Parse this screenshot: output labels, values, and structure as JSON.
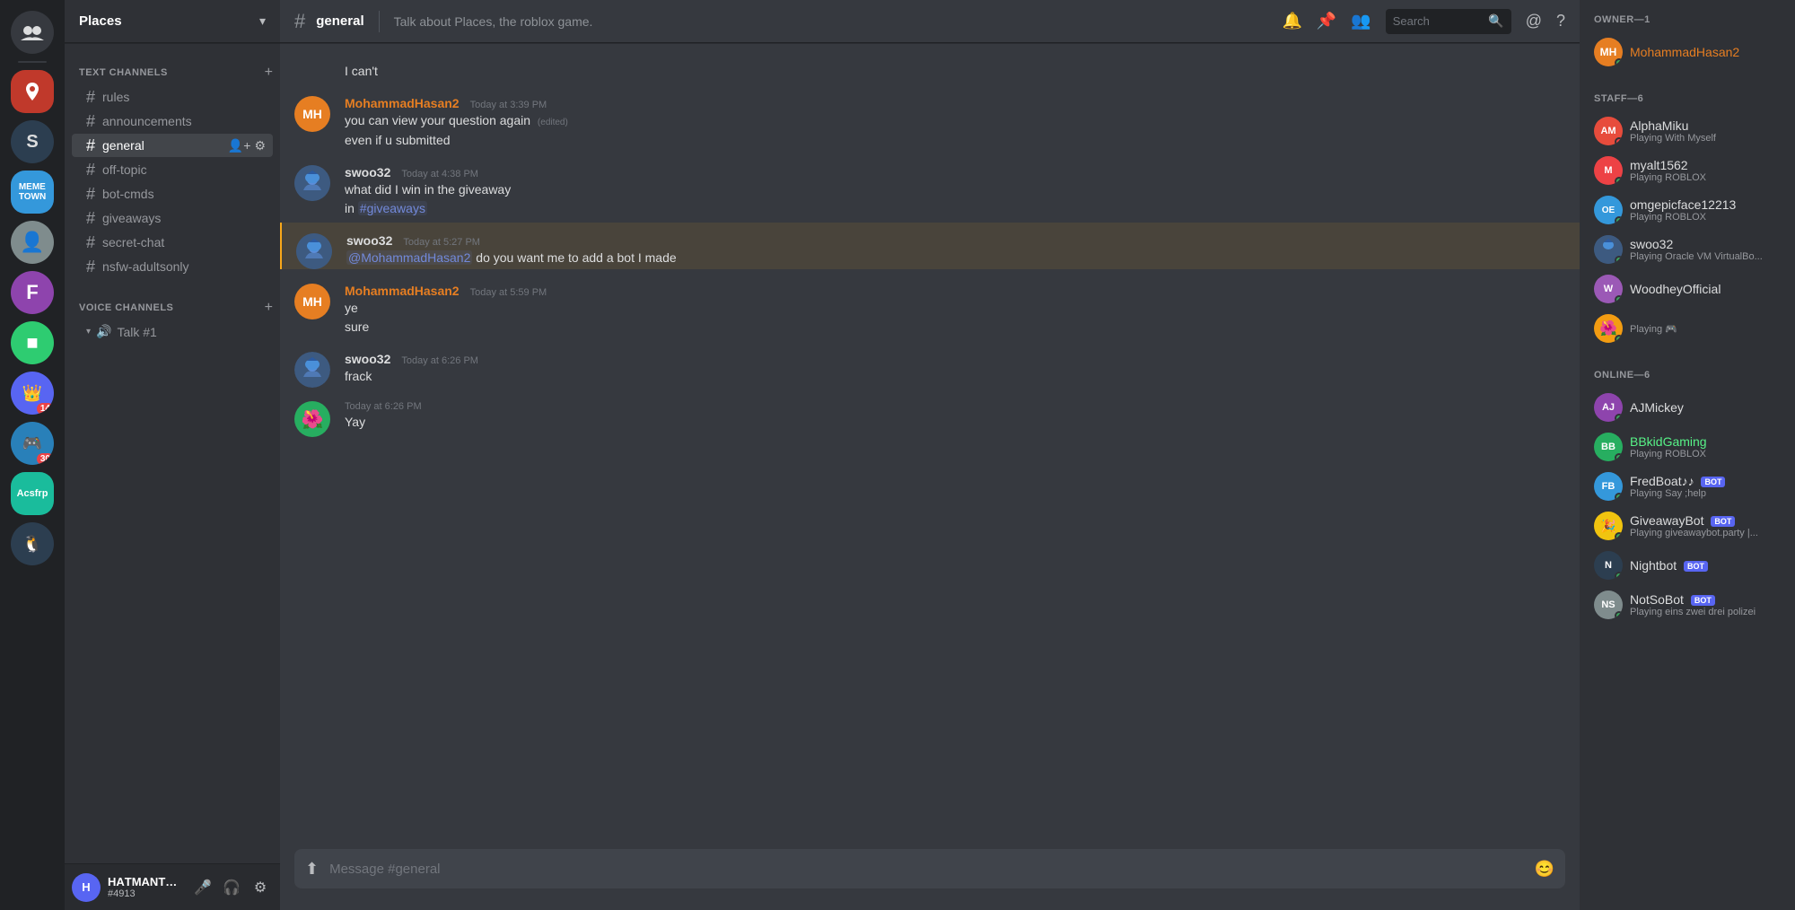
{
  "serverList": {
    "servers": [
      {
        "id": "dm",
        "label": "DM",
        "icon": "👥",
        "color": "#36393f"
      },
      {
        "id": "places",
        "label": "Places",
        "icon": "📍",
        "color": "#e74c3c",
        "active": false
      },
      {
        "id": "s",
        "label": "S",
        "icon": "S",
        "color": "#2c3e50"
      },
      {
        "id": "meme-town",
        "label": "Meme Town",
        "icon": "MT",
        "color": "#3498db"
      },
      {
        "id": "server5",
        "label": "",
        "icon": "👤",
        "color": "#95a5a6"
      },
      {
        "id": "server6",
        "label": "",
        "icon": "F",
        "color": "#e74c3c"
      },
      {
        "id": "server7",
        "label": "",
        "icon": "●",
        "color": "#2ecc71"
      },
      {
        "id": "server8",
        "label": "",
        "icon": "👑",
        "color": "#8e44ad",
        "badge": "14"
      },
      {
        "id": "server9",
        "label": "",
        "icon": "🎮",
        "color": "#2980b9",
        "badge": "30"
      },
      {
        "id": "acsfrp",
        "label": "Acsfrp",
        "icon": "AC",
        "color": "#1abc9c"
      },
      {
        "id": "server11",
        "label": "",
        "icon": "🐧",
        "color": "#27ae60"
      }
    ]
  },
  "sidebar": {
    "serverName": "Places",
    "textChannelsLabel": "TEXT CHANNELS",
    "voiceChannelsLabel": "VOICE CHANNELS",
    "channels": [
      {
        "name": "rules",
        "id": "rules"
      },
      {
        "name": "announcements",
        "id": "announcements"
      },
      {
        "name": "general",
        "id": "general",
        "active": true
      },
      {
        "name": "off-topic",
        "id": "off-topic"
      },
      {
        "name": "bot-cmds",
        "id": "bot-cmds"
      },
      {
        "name": "giveaways",
        "id": "giveaways"
      },
      {
        "name": "secret-chat",
        "id": "secret-chat"
      },
      {
        "name": "nsfw-adultsonly",
        "id": "nsfw",
        "locked": true
      }
    ],
    "voiceChannels": [
      {
        "name": "Talk #1",
        "id": "talk1"
      }
    ]
  },
  "currentUser": {
    "name": "ΗΑTΜΑNTH...",
    "discrim": "#4913",
    "avatarColor": "#5865f2"
  },
  "channelHeader": {
    "hash": "#",
    "name": "general",
    "topic": "Talk about Places, the roblox game.",
    "searchPlaceholder": "Search"
  },
  "messages": [
    {
      "id": "msg0",
      "continuedFrom": "swoo32",
      "content": "I can't",
      "avatarShow": false
    },
    {
      "id": "msg1",
      "author": "MohammadHasan2",
      "authorColor": "orange",
      "timestamp": "Today at 3:39 PM",
      "lines": [
        "you can view your question again",
        "even if u submitted"
      ],
      "edited": true,
      "hasAvatar": true,
      "avatarColor": "#e67e22",
      "avatarText": "MH"
    },
    {
      "id": "msg2",
      "author": "swoo32",
      "authorColor": "default",
      "timestamp": "Today at 4:38 PM",
      "lines": [
        "what did I win in the giveaway",
        "in #giveaways"
      ],
      "hasLink": true,
      "hasAvatar": true,
      "avatarColor": "#3d5a80",
      "avatarText": "S",
      "showHoverTools": true
    },
    {
      "id": "msg3",
      "author": "swoo32",
      "authorColor": "default",
      "timestamp": "Today at 5:27 PM",
      "lines": [
        "@MohammadHasan2 do you want me to add a bot I made"
      ],
      "hasMention": true,
      "highlighted": true,
      "hasAvatar": true,
      "avatarColor": "#3d5a80",
      "avatarText": "S"
    },
    {
      "id": "msg4",
      "author": "MohammadHasan2",
      "authorColor": "orange",
      "timestamp": "Today at 5:59 PM",
      "lines": [
        "ye",
        "sure"
      ],
      "hasAvatar": true,
      "avatarColor": "#e67e22",
      "avatarText": "MH"
    },
    {
      "id": "msg5",
      "author": "swoo32",
      "authorColor": "default",
      "timestamp": "Today at 6:26 PM",
      "lines": [
        "frack"
      ],
      "hasAvatar": true,
      "avatarColor": "#3d5a80",
      "avatarText": "S"
    },
    {
      "id": "msg6",
      "author": "",
      "timestamp": "Today at 6:26 PM",
      "lines": [
        "Yay"
      ],
      "hasAvatar": true,
      "avatarColor": "#f39c12",
      "avatarText": "🌺",
      "isBot": false,
      "showTimestampOnly": true
    }
  ],
  "messageInput": {
    "placeholder": "Message #general"
  },
  "membersPanel": {
    "sections": [
      {
        "label": "OWNER—1",
        "members": [
          {
            "name": "MohammadHasan2",
            "nameColor": "owner",
            "status": "online",
            "avatarColor": "#e67e22",
            "avatarText": "MH"
          }
        ]
      },
      {
        "label": "STAFF—6",
        "members": [
          {
            "name": "AlphaMiku",
            "nameColor": "default",
            "status": "dnd",
            "statusText": "Playing With Myself",
            "avatarColor": "#e74c3c",
            "avatarText": "A"
          },
          {
            "name": "myalt1562",
            "nameColor": "default",
            "status": "online",
            "statusText": "Playing ROBLOX",
            "avatarColor": "#ed4245",
            "avatarText": "M"
          },
          {
            "name": "omgepicface12213",
            "nameColor": "default",
            "status": "online",
            "statusText": "Playing ROBLOX",
            "avatarColor": "#3498db",
            "avatarText": "O"
          },
          {
            "name": "swoo32",
            "nameColor": "default",
            "status": "online",
            "statusText": "Playing Oracle VM VirtualBo...",
            "avatarColor": "#3d5a80",
            "avatarText": "S"
          },
          {
            "name": "WoodheyOfficial",
            "nameColor": "default",
            "status": "online",
            "statusText": "",
            "avatarColor": "#9b59b6",
            "avatarText": "W"
          },
          {
            "name": "",
            "nameColor": "default",
            "status": "online",
            "statusText": "Playing 🎮",
            "avatarColor": "#f39c12",
            "avatarText": "🌺"
          }
        ]
      },
      {
        "label": "ONLINE—6",
        "members": [
          {
            "name": "AJMickey",
            "nameColor": "default",
            "status": "online",
            "statusText": "",
            "avatarColor": "#8e44ad",
            "avatarText": "AJ"
          },
          {
            "name": "BBkidGaming",
            "nameColor": "green",
            "status": "online",
            "statusText": "Playing ROBLOX",
            "avatarColor": "#27ae60",
            "avatarText": "BB"
          },
          {
            "name": "FredBoat♪♪",
            "nameColor": "default",
            "status": "online",
            "statusText": "Playing Say ;help",
            "avatarColor": "#3498db",
            "avatarText": "FB",
            "isBot": true
          },
          {
            "name": "GiveawayBot",
            "nameColor": "default",
            "status": "online",
            "statusText": "Playing giveawaybot.party |...",
            "avatarColor": "#f1c40f",
            "avatarText": "G",
            "isBot": true
          },
          {
            "name": "Nightbot",
            "nameColor": "default",
            "status": "online",
            "statusText": "",
            "avatarColor": "#2c3e50",
            "avatarText": "N",
            "isBot": true
          },
          {
            "name": "NotSoBot",
            "nameColor": "default",
            "status": "online",
            "statusText": "Playing eins zwei drei polizei",
            "avatarColor": "#7f8c8d",
            "avatarText": "NS",
            "isBot": true
          }
        ]
      }
    ]
  }
}
